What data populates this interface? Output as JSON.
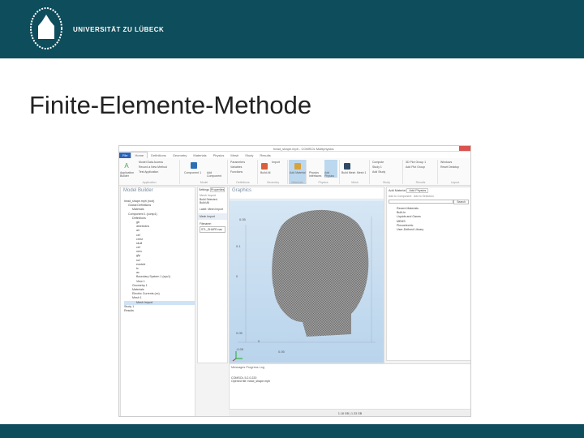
{
  "header": {
    "university": "UNIVERSITÄT ZU LÜBECK"
  },
  "slide": {
    "title": "Finite-Elemente-Methode"
  },
  "app": {
    "window_title": "head_shape.mph - COMSOL Multiphysics",
    "tabs": [
      "File",
      "Home",
      "Definitions",
      "Geometry",
      "Materials",
      "Physics",
      "Mesh",
      "Study",
      "Results"
    ],
    "ribbon_groups": [
      {
        "label": "Application",
        "items": [
          "Application Builder",
          "Model Data Access",
          "Record a New Method",
          "Test Application"
        ]
      },
      {
        "label": "Model",
        "items": [
          "Component 1",
          "Add Component"
        ]
      },
      {
        "label": "Definitions",
        "items": [
          "Parameters",
          "Variables",
          "Functions"
        ]
      },
      {
        "label": "Geometry",
        "items": [
          "Build All",
          "Import"
        ]
      },
      {
        "label": "Materials",
        "items": [
          "Add Material"
        ]
      },
      {
        "label": "Physics",
        "items": [
          "Physics Interfaces",
          "Add Physics"
        ]
      },
      {
        "label": "Mesh",
        "items": [
          "Build Mesh",
          "Mesh 1"
        ]
      },
      {
        "label": "Study",
        "items": [
          "Compute",
          "Study 1",
          "Add Study"
        ]
      },
      {
        "label": "Results",
        "items": [
          "3D Plot Group 1",
          "Add Plot Group"
        ]
      },
      {
        "label": "Layout",
        "items": [
          "Windows",
          "Reset Desktop"
        ]
      }
    ],
    "model_builder": {
      "title": "Model Builder",
      "tree": [
        "head_shape.mph (root)",
        "Global Definitions",
        "Materials",
        "Component 1 (comp1)",
        "Definitions",
        "gb",
        "dieelectric",
        "air",
        "csf",
        "crest",
        "skull",
        "cef",
        "nerv",
        "gfp",
        "scf",
        "eustcle",
        "tc",
        "ac",
        "Boundary System 1 (sys1)",
        "View 1",
        "Geometry 1",
        "Materials",
        "Electric Currents (ec)",
        "Mesh 1",
        "Mesh Import",
        "Study 1",
        "Results"
      ]
    },
    "settings": {
      "tabs": [
        "Settings",
        "Properties"
      ],
      "heading": "Mesh Import",
      "buttons": [
        "Build Selected",
        "Build All"
      ],
      "label_field": "Label:",
      "label_value": "Mesh Import",
      "section": "Mesh Import",
      "filename_label": "Filename:",
      "filename_value": "STL_SHAPE.nas"
    },
    "graphics": {
      "title": "Graphics",
      "axis_ticks": [
        "0.05",
        "0.1",
        "0",
        "0.05",
        "-0.05",
        "0",
        "0.05"
      ]
    },
    "add_material": {
      "tabs": [
        "Add Material",
        "Add Physics"
      ],
      "actions": [
        "Add to Component",
        "Add to Selection"
      ],
      "search_button": "Search",
      "items": [
        "Recent Materials",
        "Built-In",
        "Liquids and Gases",
        "MEMS",
        "Piezoelectric",
        "User-Defined Library"
      ]
    },
    "messages": {
      "tabs": [
        "Messages",
        "Progress",
        "Log"
      ],
      "lines": [
        "COMSOL 5.2.0.220",
        "Opened file: head_shape.mph"
      ]
    },
    "status": "1.18 GB | 1.33 GB"
  }
}
